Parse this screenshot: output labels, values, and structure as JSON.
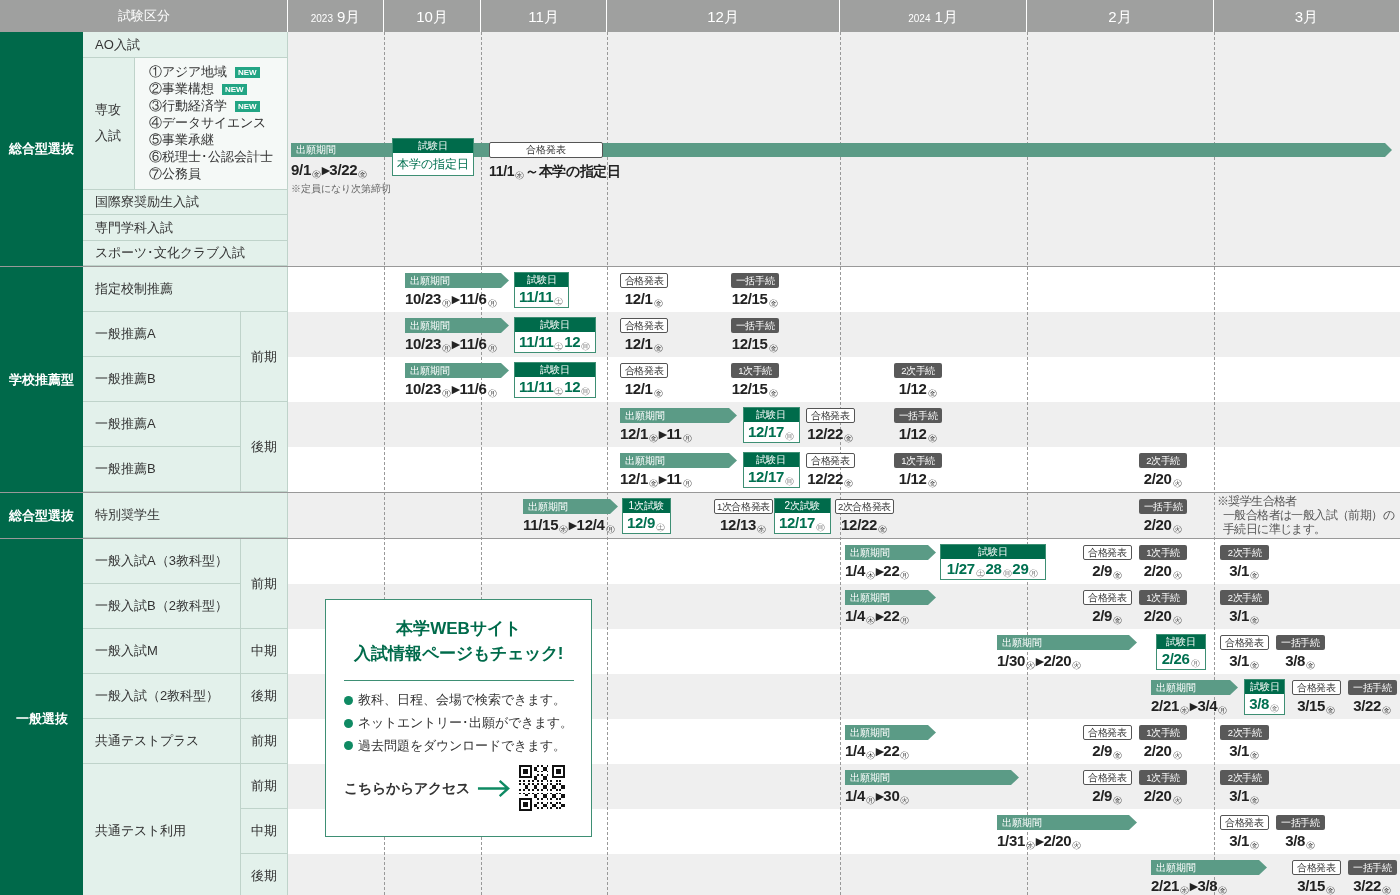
{
  "header": {
    "title": "試験区分",
    "months": [
      {
        "year": "2023",
        "label": "9月"
      },
      {
        "label": "10月"
      },
      {
        "label": "11月"
      },
      {
        "label": "12月"
      },
      {
        "year": "2024",
        "label": "1月"
      },
      {
        "label": "2月"
      },
      {
        "label": "3月"
      }
    ]
  },
  "groups": [
    {
      "kind": "comprehensive",
      "label": "総合型選抜",
      "entries": [
        {
          "kind": "row",
          "name": "AO入試"
        },
        {
          "kind": "major",
          "name_lines": [
            "専攻",
            "入試"
          ],
          "subjects": [
            {
              "name": "①アジア地域",
              "badge": "NEW"
            },
            {
              "name": "②事業構想",
              "badge": "NEW"
            },
            {
              "name": "③行動経済学",
              "badge": "NEW"
            },
            {
              "name": "④データサイエンス"
            },
            {
              "name": "⑤事業承継"
            },
            {
              "name": "⑥税理士･公認会計士"
            },
            {
              "name": "⑦公務員"
            }
          ]
        },
        {
          "kind": "row",
          "name": "国際寮奨励生入試"
        },
        {
          "kind": "row",
          "name": "専門学科入試"
        },
        {
          "kind": "row",
          "name": "スポーツ･文化クラブ入試"
        }
      ],
      "timeline": {
        "period": {
          "label": "出願期間",
          "date": "9/1$_{㊎}$▸3/22$_{㊎}$",
          "note": "※定員になり次第締切"
        },
        "exam": {
          "label": "試験日",
          "date": "本学の指定日"
        },
        "result": {
          "label": "合格発表",
          "date": "11/1$_{㊌}$～本学の指定日"
        }
      }
    },
    {
      "kind": "schedule",
      "label": "学校推薦型",
      "sections": [
        {
          "kind": "single",
          "rows": [
            {
              "name": "指定校制推薦",
              "events": [
                {
                  "kind": "period",
                  "label": "出願期間",
                  "date": "10/23$_{㊊}$▸11/6$_{㊊}$"
                },
                {
                  "kind": "exam",
                  "label": "試験日",
                  "date": "11/11$_{㊏}$"
                },
                {
                  "kind": "result",
                  "label": "合格発表",
                  "date": "12/1$_{㊎}$"
                },
                {
                  "kind": "procedure",
                  "label": "一括手続",
                  "date": "12/15$_{㊎}$"
                }
              ]
            }
          ]
        },
        {
          "kind": "term_group",
          "term": "前期",
          "rows": [
            {
              "name": "一般推薦A",
              "events": [
                {
                  "kind": "period",
                  "label": "出願期間",
                  "date": "10/23$_{㊊}$▸11/6$_{㊊}$"
                },
                {
                  "kind": "exam",
                  "label": "試験日",
                  "date": "11/11$_{㊏}$12$_{㊐}$"
                },
                {
                  "kind": "result",
                  "label": "合格発表",
                  "date": "12/1$_{㊎}$"
                },
                {
                  "kind": "procedure",
                  "label": "一括手続",
                  "date": "12/15$_{㊎}$"
                }
              ]
            },
            {
              "name": "一般推薦B",
              "events": [
                {
                  "kind": "period",
                  "label": "出願期間",
                  "date": "10/23$_{㊊}$▸11/6$_{㊊}$"
                },
                {
                  "kind": "exam",
                  "label": "試験日",
                  "date": "11/11$_{㊏}$12$_{㊐}$"
                },
                {
                  "kind": "result",
                  "label": "合格発表",
                  "date": "12/1$_{㊎}$"
                },
                {
                  "kind": "procedure",
                  "label": "1次手続",
                  "date": "12/15$_{㊎}$"
                },
                {
                  "kind": "procedure",
                  "label": "2次手続",
                  "date": "1/12$_{㊎}$"
                }
              ]
            }
          ]
        },
        {
          "kind": "term_group",
          "term": "後期",
          "rows": [
            {
              "name": "一般推薦A",
              "events": [
                {
                  "kind": "period",
                  "label": "出願期間",
                  "date": "12/1$_{㊎}$▸11$_{㊊}$"
                },
                {
                  "kind": "exam",
                  "label": "試験日",
                  "date": "12/17$_{㊐}$"
                },
                {
                  "kind": "result",
                  "label": "合格発表",
                  "date": "12/22$_{㊎}$"
                },
                {
                  "kind": "procedure",
                  "label": "一括手続",
                  "date": "1/12$_{㊎}$"
                }
              ]
            },
            {
              "name": "一般推薦B",
              "events": [
                {
                  "kind": "period",
                  "label": "出願期間",
                  "date": "12/1$_{㊎}$▸11$_{㊊}$"
                },
                {
                  "kind": "exam",
                  "label": "試験日",
                  "date": "12/17$_{㊐}$"
                },
                {
                  "kind": "result",
                  "label": "合格発表",
                  "date": "12/22$_{㊎}$"
                },
                {
                  "kind": "procedure",
                  "label": "1次手続",
                  "date": "1/12$_{㊎}$"
                },
                {
                  "kind": "procedure",
                  "label": "2次手続",
                  "date": "2/20$_{㊋}$"
                }
              ]
            }
          ]
        }
      ]
    },
    {
      "kind": "schedule",
      "label": "総合型選抜",
      "sections": [
        {
          "kind": "single",
          "rows": [
            {
              "name": "特別奨学生",
              "events": [
                {
                  "kind": "period",
                  "label": "出願期間",
                  "date": "11/15$_{㊌}$▸12/4$_{㊊}$"
                },
                {
                  "kind": "exam",
                  "label": "1次試験",
                  "date": "12/9$_{㊏}$"
                },
                {
                  "kind": "result",
                  "label": "1次合格発表",
                  "date": "12/13$_{㊌}$"
                },
                {
                  "kind": "exam",
                  "label": "2次試験",
                  "date": "12/17$_{㊐}$"
                },
                {
                  "kind": "result",
                  "label": "2次合格発表",
                  "date": "12/22$_{㊎}$"
                },
                {
                  "kind": "procedure",
                  "label": "一括手続",
                  "date": "2/20$_{㊋}$"
                }
              ],
              "note_lines": [
                "※奨学生合格者",
                "一般合格者は一般入試（前期）の",
                "手続日に準じます。"
              ]
            }
          ]
        }
      ]
    },
    {
      "kind": "schedule",
      "label": "一般選抜",
      "sections": [
        {
          "kind": "term_group",
          "term": "前期",
          "rows": [
            {
              "name": "一般入試A（3教科型）",
              "events": [
                {
                  "kind": "period",
                  "label": "出願期間",
                  "date": "1/4$_{㊍}$▸22$_{㊊}$"
                },
                {
                  "kind": "exam",
                  "label": "試験日",
                  "date": "1/27$_{㊏}$28$_{㊐}$29$_{㊊}$"
                },
                {
                  "kind": "result",
                  "label": "合格発表",
                  "date": "2/9$_{㊎}$"
                },
                {
                  "kind": "procedure",
                  "label": "1次手続",
                  "date": "2/20$_{㊋}$"
                },
                {
                  "kind": "procedure",
                  "label": "2次手続",
                  "date": "3/1$_{㊎}$"
                }
              ]
            },
            {
              "name": "一般入試B（2教科型）",
              "events": [
                {
                  "kind": "period",
                  "label": "出願期間",
                  "date": "1/4$_{㊍}$▸22$_{㊊}$"
                },
                {
                  "kind": "result",
                  "label": "合格発表",
                  "date": "2/9$_{㊎}$"
                },
                {
                  "kind": "procedure",
                  "label": "1次手続",
                  "date": "2/20$_{㊋}$"
                },
                {
                  "kind": "procedure",
                  "label": "2次手続",
                  "date": "3/1$_{㊎}$"
                }
              ]
            }
          ]
        },
        {
          "kind": "term_group",
          "term": "中期",
          "rows": [
            {
              "name": "一般入試M",
              "events": [
                {
                  "kind": "period",
                  "label": "出願期間",
                  "date": "1/30$_{㊋}$▸2/20$_{㊋}$"
                },
                {
                  "kind": "exam",
                  "label": "試験日",
                  "date": "2/26$_{㊊}$"
                },
                {
                  "kind": "result",
                  "label": "合格発表",
                  "date": "3/1$_{㊎}$"
                },
                {
                  "kind": "procedure",
                  "label": "一括手続",
                  "date": "3/8$_{㊎}$"
                }
              ]
            }
          ]
        },
        {
          "kind": "term_group",
          "term": "後期",
          "rows": [
            {
              "name": "一般入試（2教科型）",
              "events": [
                {
                  "kind": "period",
                  "label": "出願期間",
                  "date": "2/21$_{㊌}$▸3/4$_{㊊}$"
                },
                {
                  "kind": "exam",
                  "label": "試験日",
                  "date": "3/8$_{㊎}$"
                },
                {
                  "kind": "result",
                  "label": "合格発表",
                  "date": "3/15$_{㊎}$"
                },
                {
                  "kind": "procedure",
                  "label": "一括手続",
                  "date": "3/22$_{㊎}$"
                }
              ]
            }
          ]
        },
        {
          "kind": "term_group",
          "term": "前期",
          "rows": [
            {
              "name": "共通テストプラス",
              "events": [
                {
                  "kind": "period",
                  "label": "出願期間",
                  "date": "1/4$_{㊍}$▸22$_{㊊}$"
                },
                {
                  "kind": "result",
                  "label": "合格発表",
                  "date": "2/9$_{㊎}$"
                },
                {
                  "kind": "procedure",
                  "label": "1次手続",
                  "date": "2/20$_{㊋}$"
                },
                {
                  "kind": "procedure",
                  "label": "2次手続",
                  "date": "3/1$_{㊎}$"
                }
              ]
            }
          ]
        },
        {
          "kind": "name_group",
          "name": "共通テスト利用",
          "rows": [
            {
              "term": "前期",
              "events": [
                {
                  "kind": "period",
                  "label": "出願期間",
                  "date": "1/4$_{㊊}$▸30$_{㊋}$"
                },
                {
                  "kind": "result",
                  "label": "合格発表",
                  "date": "2/9$_{㊎}$"
                },
                {
                  "kind": "procedure",
                  "label": "1次手続",
                  "date": "2/20$_{㊋}$"
                },
                {
                  "kind": "procedure",
                  "label": "2次手続",
                  "date": "3/1$_{㊎}$"
                }
              ]
            },
            {
              "term": "中期",
              "events": [
                {
                  "kind": "period",
                  "label": "出願期間",
                  "date": "1/31$_{㊌}$▸2/20$_{㊋}$"
                },
                {
                  "kind": "result",
                  "label": "合格発表",
                  "date": "3/1$_{㊎}$"
                },
                {
                  "kind": "procedure",
                  "label": "一括手続",
                  "date": "3/8$_{㊎}$"
                }
              ]
            },
            {
              "term": "後期",
              "events": [
                {
                  "kind": "period",
                  "label": "出願期間",
                  "date": "2/21$_{㊌}$▸3/8$_{㊎}$"
                },
                {
                  "kind": "result",
                  "label": "合格発表",
                  "date": "3/15$_{㊎}$"
                },
                {
                  "kind": "procedure",
                  "label": "一括手続",
                  "date": "3/22$_{㊎}$"
                }
              ]
            }
          ]
        }
      ]
    }
  ],
  "web_notice": {
    "title_lines": [
      "本学WEBサイト",
      "入試情報ページもチェック!"
    ],
    "bullets": [
      "教科、日程、会場で検索できます。",
      "ネットエントリー･出願ができます。",
      "過去問題をダウンロードできます。"
    ],
    "access_label": "こちらからアクセス"
  }
}
